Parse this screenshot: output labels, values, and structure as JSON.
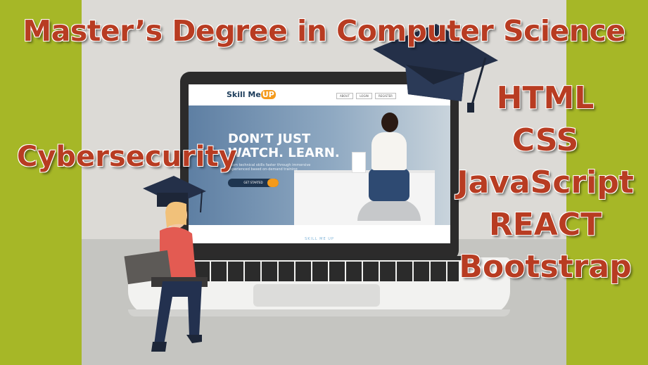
{
  "title": "Master’s Degree in Computer Science",
  "left_label": "Cybersecurity",
  "skills": [
    "HTML",
    "CSS",
    "JavaScript",
    "REACT",
    "Bootstrap"
  ],
  "screen": {
    "logo": "Skill Me",
    "logo_badge": "UP",
    "nav_items": [
      "ABOUT",
      "LOGIN",
      "REGISTER"
    ],
    "hero_title_line1": "DON’T JUST",
    "hero_title_line2": "WATCH. LEARN.",
    "hero_subtitle": "Learn technical skills faster through immersive experienced based on-demand training",
    "cta": "GET STARTED",
    "footer": "SKILL ME UP"
  },
  "colors": {
    "accent_red": "#b83c22",
    "side_green": "#a6b727",
    "background_gray": "#dcdad6"
  }
}
